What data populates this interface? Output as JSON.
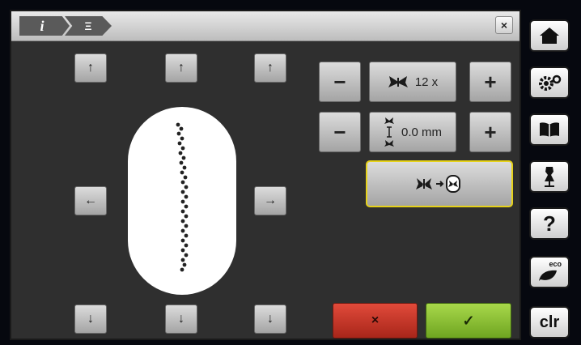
{
  "header": {
    "crumb_info_label": "i",
    "crumb_stitch_label": "Ξ",
    "close_label": "×"
  },
  "move": {
    "up": "↑",
    "down": "↓",
    "left": "←",
    "right": "→"
  },
  "repeat": {
    "minus_label": "−",
    "value": "12 x",
    "plus_label": "+",
    "icon": "butterfly-icon"
  },
  "spacing": {
    "minus_label": "−",
    "value": "0.0 mm",
    "plus_label": "+",
    "icon": "stitch-spacing-icon"
  },
  "hoop_button_icon": "center-in-hoop-icon",
  "actions": {
    "cancel_label": "×",
    "confirm_label": "✓"
  },
  "sidebar": {
    "items": [
      {
        "icon": "home-icon"
      },
      {
        "icon": "settings-icon"
      },
      {
        "icon": "book-icon"
      },
      {
        "icon": "dressform-icon"
      },
      {
        "icon": "help-icon",
        "label": "?"
      },
      {
        "icon": "eco-icon",
        "label": "eco"
      },
      {
        "icon": "clear-icon",
        "label": "clr"
      }
    ]
  },
  "colors": {
    "accent_border": "#e6d21a",
    "cancel": "#c8392b",
    "confirm": "#8bc33a",
    "panel": "#2f2f2f"
  }
}
